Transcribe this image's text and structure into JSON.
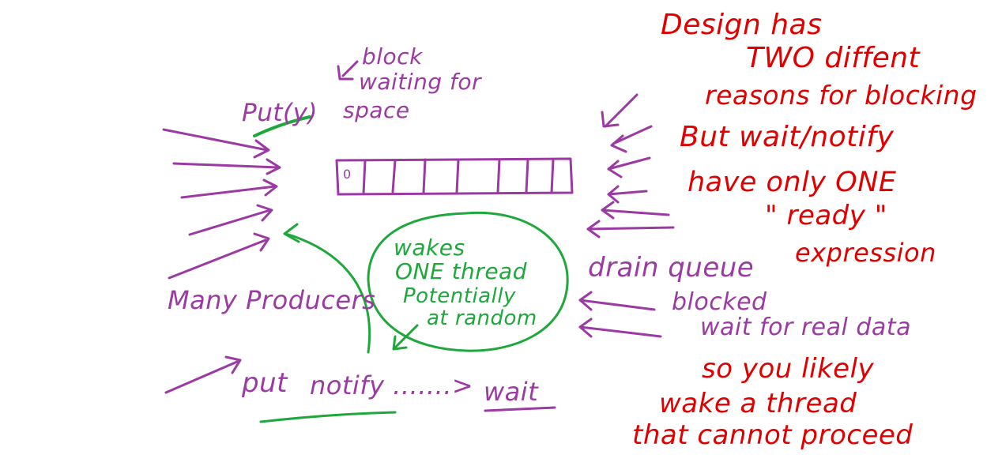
{
  "colors": {
    "producer": "#9b3aa3",
    "design_notes": "#e00000",
    "notify": "#1ea83c",
    "ink_background": "#ffffff"
  },
  "labels": {
    "put_y": "Put(y)",
    "block_waiting_line1": "block",
    "block_waiting_line2": "waiting for",
    "block_waiting_line3": "space",
    "buffer_first_slot": "0",
    "many_producers": "Many Producers",
    "put": "put",
    "notify": "notify .......>",
    "wait": "wait",
    "drain_queue": "drain queue",
    "blocked": "blocked",
    "wait_for_real_data": "wait for real data",
    "wakes_line1": "wakes",
    "wakes_line2": "ONE thread",
    "wakes_line3": "Potentially",
    "wakes_line4": "at random"
  },
  "design_notes": {
    "line1": "Design has",
    "line2": "TWO diffent",
    "line3": "reasons for blocking",
    "line4": "But wait/notify",
    "line5": "have only ONE",
    "line6": "\" ready \"",
    "line7": "expression",
    "line8": "so you likely",
    "line9": "wake a thread",
    "line10": "that cannot proceed"
  }
}
